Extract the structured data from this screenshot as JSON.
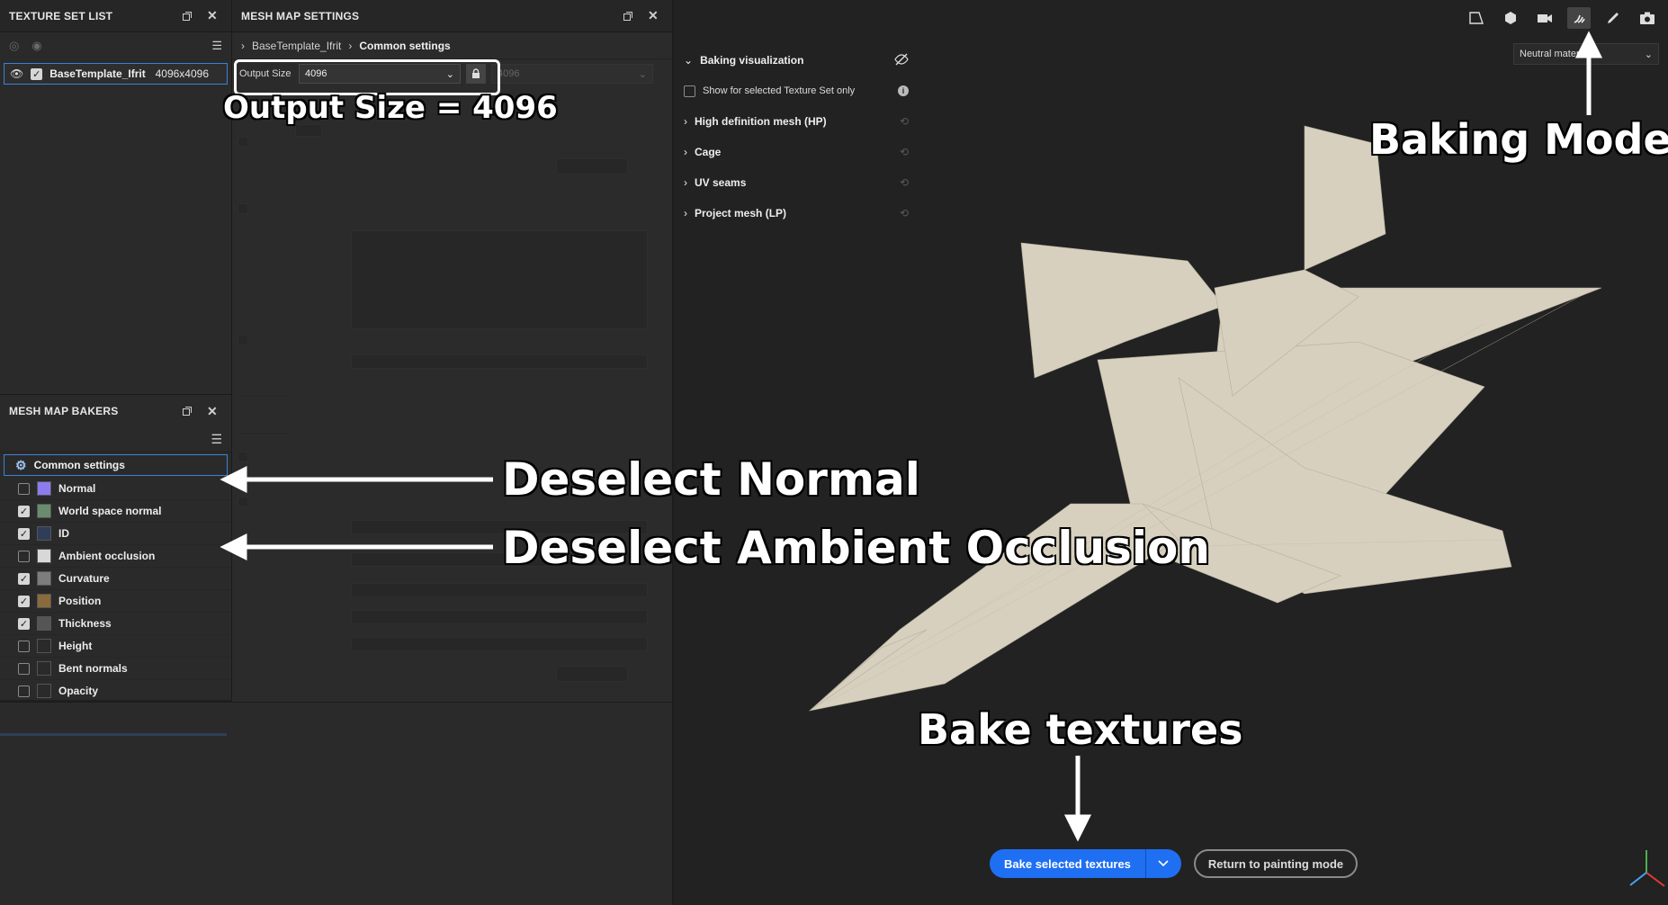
{
  "texture_set_list": {
    "title": "TEXTURE SET LIST",
    "item": {
      "name": "BaseTemplate_Ifrit",
      "resolution": "4096x4096"
    }
  },
  "mesh_map_settings": {
    "title": "MESH MAP SETTINGS",
    "breadcrumb": {
      "root": "BaseTemplate_Ifrit",
      "current": "Common settings"
    },
    "output_size": {
      "label": "Output Size",
      "value": "4096",
      "linked_value": "4096"
    }
  },
  "mesh_map_bakers": {
    "title": "MESH MAP BAKERS",
    "common": "Common settings",
    "items": [
      {
        "label": "Normal",
        "checked": false,
        "color": "#8c7cf0"
      },
      {
        "label": "World space normal",
        "checked": true,
        "color": "#6b8b6e"
      },
      {
        "label": "ID",
        "checked": true,
        "color": "#2f3d57"
      },
      {
        "label": "Ambient occlusion",
        "checked": false,
        "color": "#d8d8d8"
      },
      {
        "label": "Curvature",
        "checked": true,
        "color": "#7d7d7d"
      },
      {
        "label": "Position",
        "checked": true,
        "color": "#8a6b3c"
      },
      {
        "label": "Thickness",
        "checked": true,
        "color": "#555555"
      },
      {
        "label": "Height",
        "checked": false,
        "color": "#2a2a2a"
      },
      {
        "label": "Bent normals",
        "checked": false,
        "color": "#2a2a2a"
      },
      {
        "label": "Opacity",
        "checked": false,
        "color": "#2a2a2a"
      }
    ]
  },
  "viewport": {
    "material_select": "Neutral material",
    "visualization": {
      "title": "Baking visualization",
      "show_selected": "Show for selected Texture Set only",
      "sections": [
        "High definition mesh (HP)",
        "Cage",
        "UV seams",
        "Project mesh (LP)"
      ]
    },
    "bake_button": "Bake selected textures",
    "return_button": "Return to painting mode"
  },
  "annotations": {
    "output_size": "Output Size = 4096",
    "baking_mode": "Baking Mode",
    "deselect_normal": "Deselect Normal",
    "deselect_ao": "Deselect Ambient Occlusion",
    "bake_textures": "Bake textures"
  }
}
